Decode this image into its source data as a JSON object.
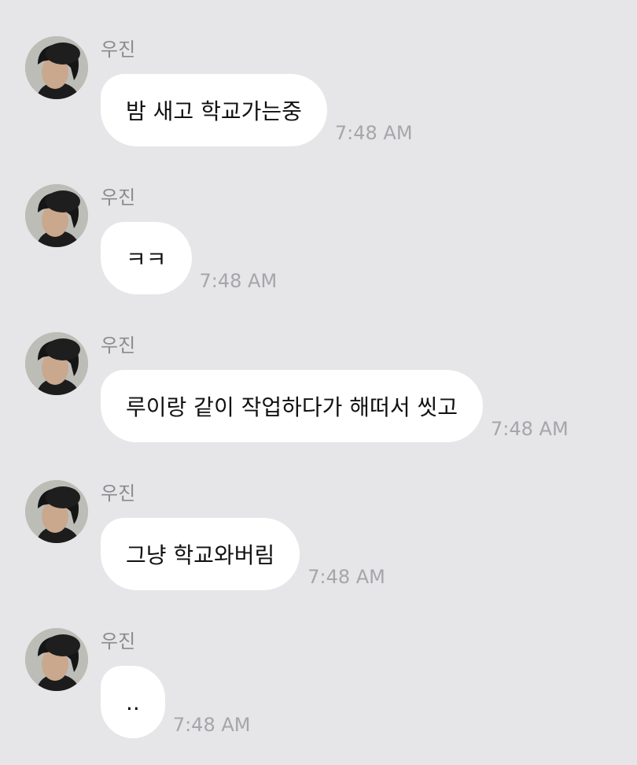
{
  "messages": [
    {
      "sender": "우진",
      "text": "밤 새고 학교가는중",
      "time": "7:48 AM"
    },
    {
      "sender": "우진",
      "text": "ㅋㅋ",
      "time": "7:48 AM"
    },
    {
      "sender": "우진",
      "text": "루이랑 같이 작업하다가 해떠서 씻고",
      "time": "7:48 AM"
    },
    {
      "sender": "우진",
      "text": "그냥 학교와버림",
      "time": "7:48 AM"
    },
    {
      "sender": "우진",
      "text": "..",
      "time": "7:48 AM"
    }
  ],
  "colors": {
    "background": "#e6e6e8",
    "bubble": "#ffffff",
    "sender_name": "#8a8a8e",
    "timestamp": "#a6a6aa"
  },
  "icons": {
    "avatar": "profile-photo"
  }
}
